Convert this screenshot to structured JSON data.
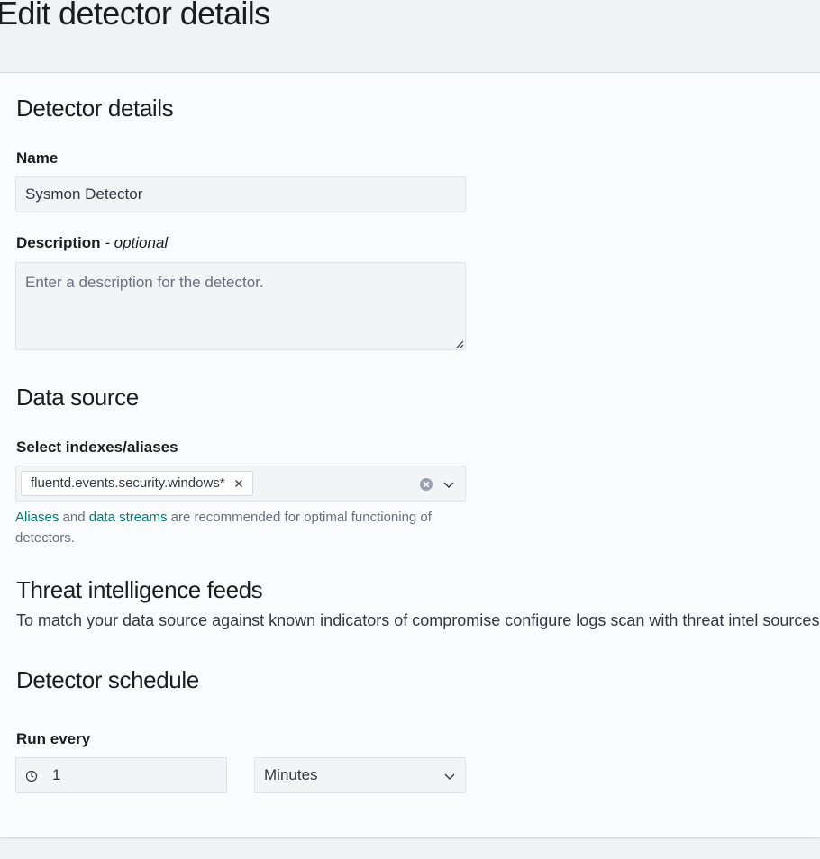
{
  "page": {
    "title": "Edit detector details"
  },
  "details": {
    "heading": "Detector details",
    "name_label": "Name",
    "name_value": "Sysmon Detector",
    "description_label": "Description",
    "description_optional": "- optional",
    "description_placeholder": "Enter a description for the detector.",
    "description_value": ""
  },
  "data_source": {
    "heading": "Data source",
    "select_label": "Select indexes/aliases",
    "selected_option": "fluentd.events.security.windows*",
    "help_link_aliases": "Aliases",
    "help_and": "and",
    "help_link_streams": "data streams",
    "help_rest": "are recommended for optimal functioning of detectors."
  },
  "threat_intel": {
    "heading": "Threat intelligence feeds",
    "description": "To match your data source against known indicators of compromise configure logs scan with threat intel sources"
  },
  "schedule": {
    "heading": "Detector schedule",
    "run_every_label": "Run every",
    "interval_value": "1",
    "unit_value": "Minutes"
  },
  "icons": {
    "remove": "close-icon",
    "clear": "clear-circle-icon",
    "chevron": "chevron-down-icon",
    "clock": "clock-icon",
    "resize": "resize-grip-icon"
  },
  "colors": {
    "link": "#017d73",
    "page_bg": "#f1f2f4",
    "panel_bg": "#fafbfc",
    "field_bg": "#f3f4f6"
  }
}
